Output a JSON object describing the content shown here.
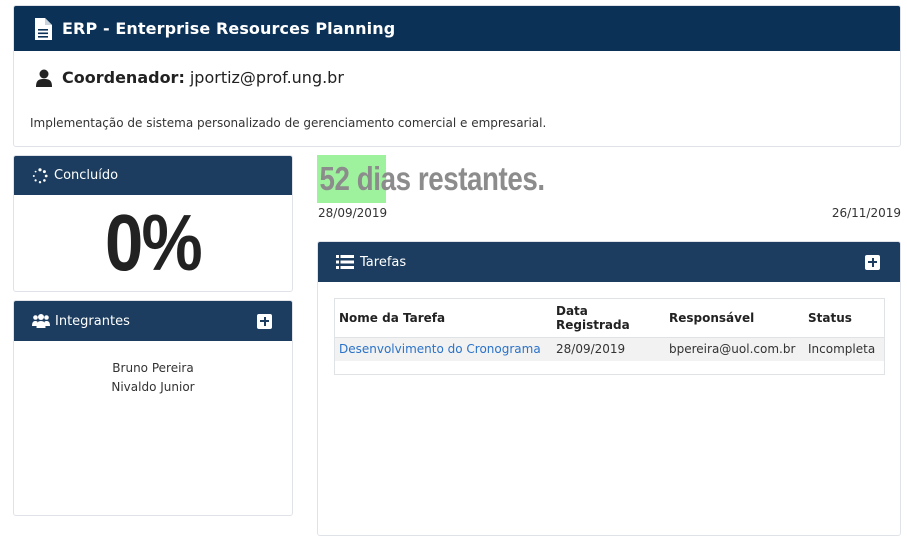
{
  "project": {
    "title": "ERP - Enterprise Resources Planning",
    "coordinator_label": "Coordenador:",
    "coordinator_email": "jportiz@prof.ung.br",
    "description": "Implementação de sistema personalizado de gerenciamento comercial e empresarial."
  },
  "progress": {
    "header": "Concluído",
    "value": "0%"
  },
  "members": {
    "header": "Integrantes",
    "list": [
      "Bruno Pereira",
      "Nivaldo Junior"
    ]
  },
  "schedule": {
    "remaining": "52 dias restantes.",
    "start_date": "28/09/2019",
    "end_date": "26/11/2019",
    "highlight_color": "#9ef29e"
  },
  "tasks": {
    "header": "Tarefas",
    "columns": [
      "Nome da Tarefa",
      "Data Registrada",
      "Responsável",
      "Status"
    ],
    "rows": [
      [
        "Desenvolvimento do Cronograma",
        "28/09/2019",
        "bpereira@uol.com.br",
        "Incompleta"
      ]
    ]
  },
  "colors": {
    "header_dark": "#0b3157",
    "card_header": "#1c3d5f",
    "link": "#2a72c8"
  },
  "icons": {
    "project": "document-icon",
    "coordinator": "user-icon",
    "progress": "spinner-icon",
    "members": "users-icon",
    "tasks": "list-icon",
    "add": "plus-square-icon"
  }
}
